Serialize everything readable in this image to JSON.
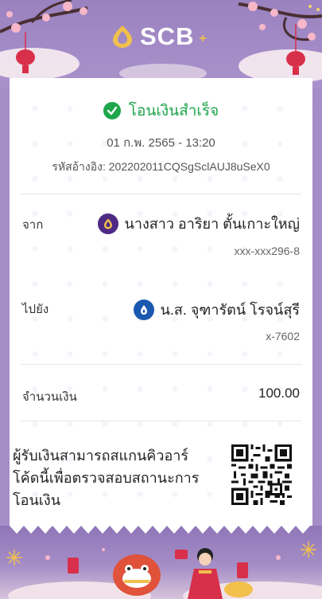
{
  "header": {
    "brand": "SCB",
    "brand_suffix": "+"
  },
  "receipt": {
    "status": "โอนเงินสำเร็จ",
    "datetime": "01 ก.พ. 2565 - 13:20",
    "reference": "รหัสอ้างอิง: 202202011CQSgSclAUJ8uSeX0",
    "from": {
      "label": "จาก",
      "name": "นางสาว อาริยา ตั้นเกาะใหญ่",
      "account": "xxx-xxx296-8",
      "bank_icon": "scb-icon",
      "bank_color": "#4e2a84"
    },
    "to": {
      "label": "ไปยัง",
      "name": "น.ส. จุฑารัตน์ โรจน์สุรี",
      "account": "x-7602",
      "bank_icon": "ktb-icon",
      "bank_color": "#1b59b0"
    },
    "amount": {
      "label": "จำนวนเงิน",
      "value": "100.00"
    },
    "qr_note": "ผู้รับเงินสามารถสแกนคิวอาร์โค้ดนี้เพื่อตรวจสอบสถานะการโอนเงิน"
  },
  "colors": {
    "success": "#1ea64b",
    "frame": "#a58ec7",
    "scb_purple": "#4e2a84"
  }
}
